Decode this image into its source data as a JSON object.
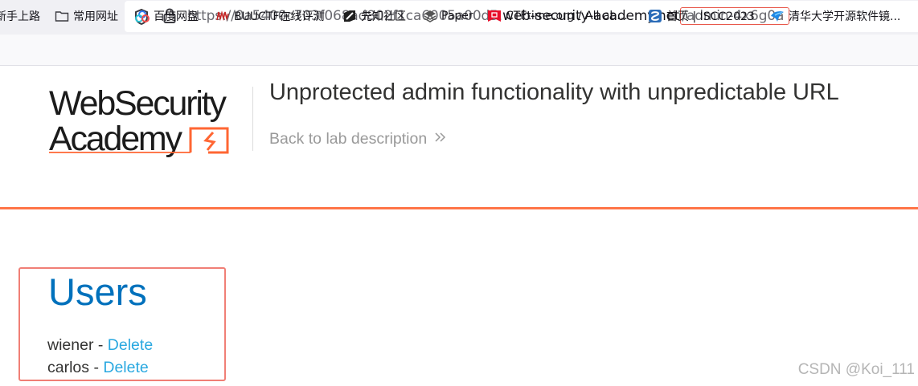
{
  "browser": {
    "url_prefix": "https://0a5400c703f068ad802f1ca6005a00d5.",
    "url_host": "web-security-academy.net",
    "url_path": "/admin-4x6g0a",
    "bookmarks": [
      {
        "label": "新手上路",
        "icon": "none"
      },
      {
        "label": "常用网址",
        "icon": "folder-icon"
      },
      {
        "label": "百度网盘",
        "icon": "baidu-pan-icon"
      },
      {
        "label": "BUUCTF在线评测",
        "icon": "buuctf-icon"
      },
      {
        "label": "先知社区",
        "icon": "xianzhi-icon"
      },
      {
        "label": "Paper",
        "icon": "paper-icon"
      },
      {
        "label": "CTFtime.org / All ab...",
        "icon": "ctftime-icon"
      },
      {
        "label": "首页 | ISCC2023",
        "icon": "iscc-icon"
      },
      {
        "label": "清华大学开源软件镜...",
        "icon": "tuna-icon"
      }
    ]
  },
  "header": {
    "logo_line1": "WebSecurity",
    "logo_line2": "Academy",
    "lab_title": "Unprotected admin functionality with unpredictable URL",
    "back_link": "Back to lab description"
  },
  "main": {
    "heading": "Users",
    "users": [
      {
        "name": "wiener",
        "separator": " - ",
        "action": "Delete"
      },
      {
        "name": "carlos",
        "separator": " - ",
        "action": "Delete"
      }
    ]
  },
  "watermark": "CSDN @Koi_111",
  "colors": {
    "accent_orange": "#ff6633",
    "link_blue": "#29a8e0",
    "heading_blue": "#0071bc",
    "highlight_red": "#f07f76"
  }
}
